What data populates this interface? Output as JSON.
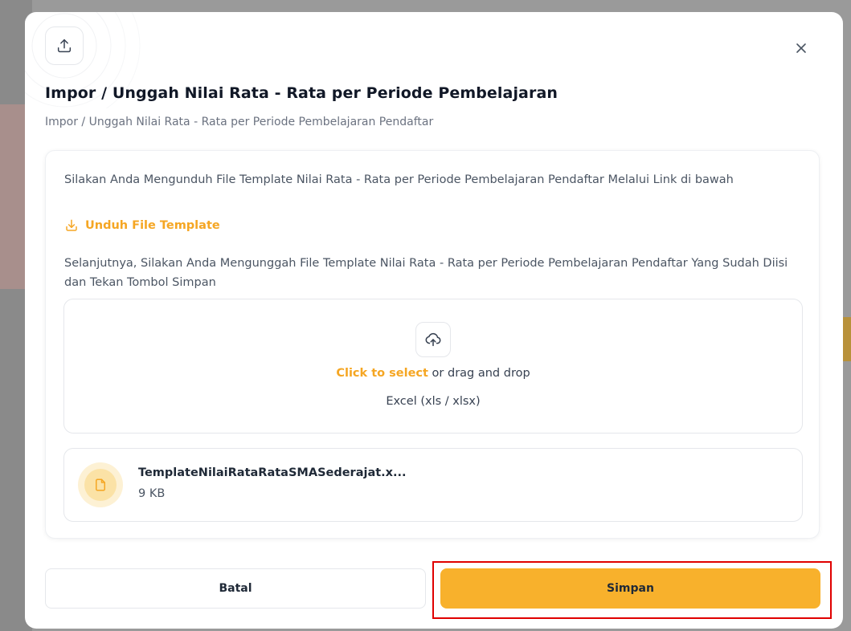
{
  "modal": {
    "title": "Impor / Unggah Nilai Rata - Rata per Periode Pembelajaran",
    "subtitle": "Impor / Unggah Nilai Rata - Rata per Periode Pembelajaran Pendaftar",
    "header_icon": "upload-icon",
    "close_icon": "close-icon"
  },
  "card": {
    "instruction_1": "Silakan Anda Mengunduh File Template Nilai Rata - Rata per Periode Pembelajaran Pendaftar Melalui Link di bawah",
    "download_label": "Unduh File Template",
    "download_icon": "download-icon",
    "instruction_2": "Selanjutnya, Silakan Anda Mengunggah File Template Nilai Rata - Rata per Periode Pembelajaran Pendaftar Yang Sudah Diisi dan Tekan Tombol Simpan"
  },
  "dropzone": {
    "icon": "cloud-upload-icon",
    "select_link": "Click to select",
    "select_rest": " or drag and drop",
    "hint": "Excel (xls / xlsx)"
  },
  "file": {
    "icon": "file-icon",
    "name": "TemplateNilaiRataRataSMASederajat.x...",
    "size": "9 KB"
  },
  "actions": {
    "cancel_label": "Batal",
    "save_label": "Simpan"
  },
  "colors": {
    "accent": "#F8B12C",
    "link": "#F5A623",
    "highlight": "#E00000"
  }
}
